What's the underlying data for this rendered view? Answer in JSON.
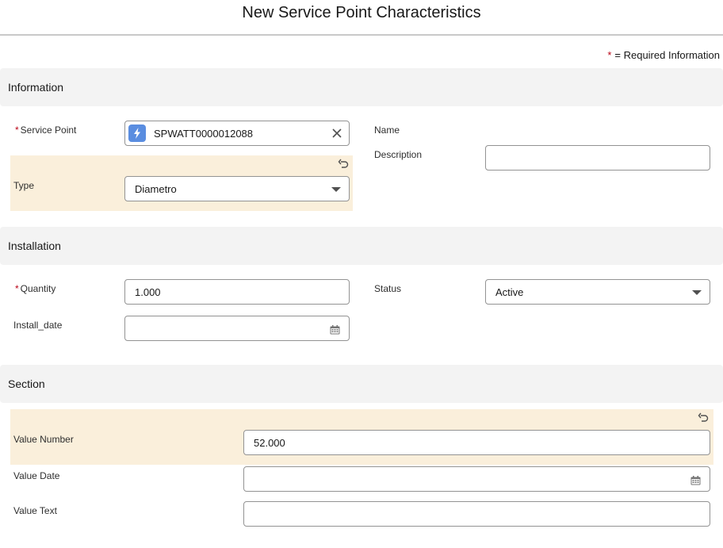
{
  "modal": {
    "title": "New Service Point Characteristics"
  },
  "required_legend": {
    "star": "*",
    "text": "= Required Information"
  },
  "sections": {
    "information": {
      "title": "Information",
      "service_point": {
        "label": "Service Point",
        "value": "SPWATT0000012088",
        "icon": "lightning-bolt-icon"
      },
      "type": {
        "label": "Type",
        "value": "Diametro"
      },
      "name": {
        "label": "Name"
      },
      "description": {
        "label": "Description",
        "value": ""
      }
    },
    "installation": {
      "title": "Installation",
      "quantity": {
        "label": "Quantity",
        "value": "1.000"
      },
      "install_date": {
        "label": "Install_date",
        "value": ""
      },
      "status": {
        "label": "Status",
        "value": "Active"
      }
    },
    "section": {
      "title": "Section",
      "value_number": {
        "label": "Value Number",
        "value": "52.000"
      },
      "value_date": {
        "label": "Value Date",
        "value": ""
      },
      "value_text": {
        "label": "Value Text",
        "value": ""
      }
    }
  },
  "required_star": "*",
  "colors": {
    "edited_highlight": "#faefdb",
    "section_bg": "#f3f3f3",
    "required": "#ba0517",
    "lookup_icon": "#5a8de0"
  }
}
